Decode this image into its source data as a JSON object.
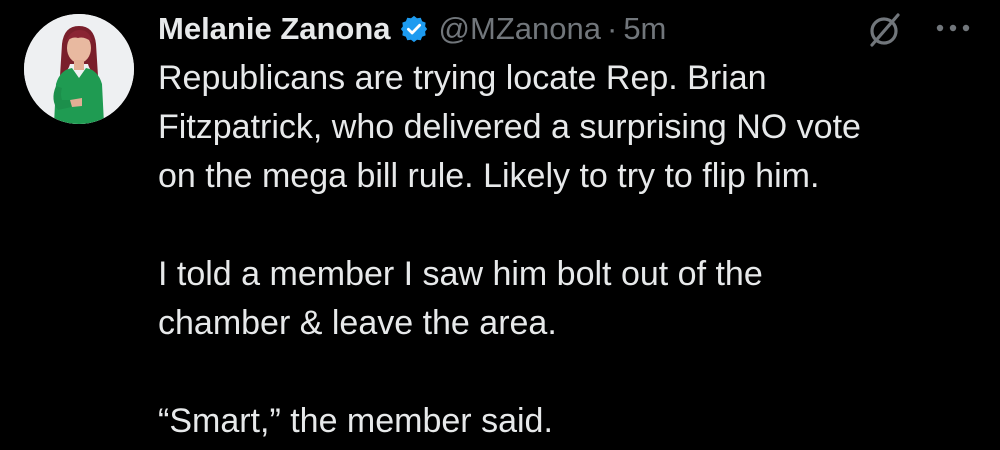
{
  "author": {
    "display_name": "Melanie Zanona",
    "handle": "@MZanona",
    "separator": "·",
    "timestamp": "5m",
    "verified_icon": "verified-badge-icon",
    "verified_color": "#1d9bf0"
  },
  "toolbar": {
    "grok_icon": "grok-icon",
    "more_icon": "more-options-icon"
  },
  "tweet": {
    "paragraphs": [
      {
        "lines": [
          "Republicans are trying locate Rep. Brian",
          "Fitzpatrick, who delivered a surprising NO vote",
          "on the mega bill rule. Likely to try to flip him."
        ]
      },
      {
        "lines": [
          "I told a member I saw him bolt out of the",
          "chamber & leave the area."
        ]
      },
      {
        "lines": [
          "“Smart,” the member said."
        ]
      }
    ]
  },
  "colors": {
    "background": "#000000",
    "text_primary": "#e7e9ea",
    "text_secondary": "#71767b"
  }
}
